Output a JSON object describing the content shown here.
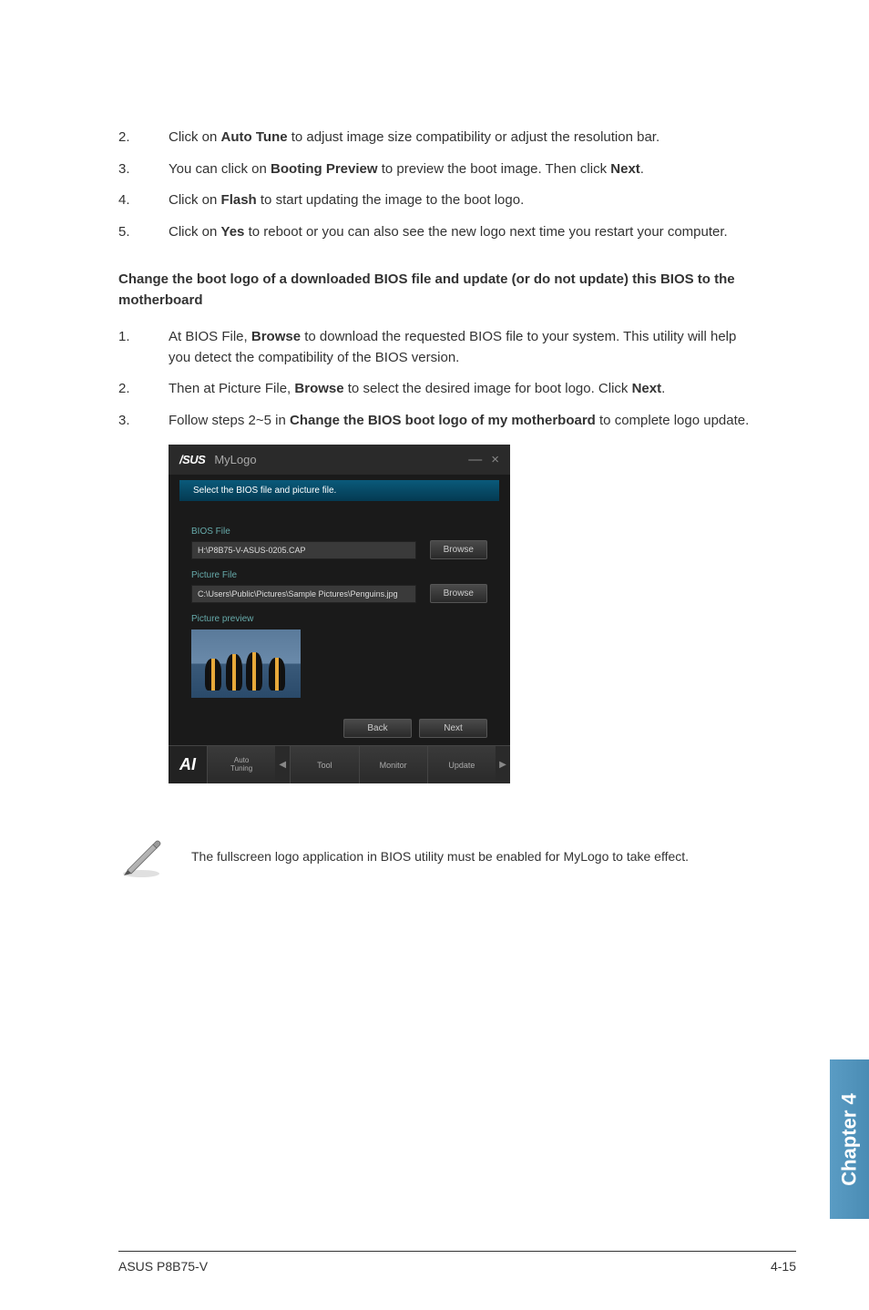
{
  "list1": [
    {
      "num": "2.",
      "parts": [
        "Click on ",
        {
          "b": "Auto Tune"
        },
        " to adjust image size compatibility or adjust the resolution bar."
      ]
    },
    {
      "num": "3.",
      "parts": [
        "You can click on ",
        {
          "b": "Booting Preview"
        },
        " to preview the boot image. Then click ",
        {
          "b": "Next"
        },
        "."
      ]
    },
    {
      "num": "4.",
      "parts": [
        "Click on ",
        {
          "b": "Flash"
        },
        " to start updating the image to the boot logo."
      ]
    },
    {
      "num": "5.",
      "parts": [
        "Click on ",
        {
          "b": "Yes"
        },
        " to reboot or you can also see the new logo next time you restart your computer."
      ]
    }
  ],
  "heading": "Change the boot logo of a downloaded BIOS file and update (or do not update) this BIOS to the motherboard",
  "list2": [
    {
      "num": "1.",
      "parts": [
        "At BIOS File, ",
        {
          "b": "Browse"
        },
        " to download the requested BIOS file to your system. This utility will help you detect the compatibility of the BIOS version."
      ]
    },
    {
      "num": "2.",
      "parts": [
        "Then at Picture File, ",
        {
          "b": "Browse"
        },
        " to select the desired image for boot logo. Click ",
        {
          "b": "Next"
        },
        "."
      ]
    },
    {
      "num": "3.",
      "parts": [
        "Follow steps 2~5 in ",
        {
          "b": "Change the BIOS boot logo of my motherboard"
        },
        " to complete logo update."
      ]
    }
  ],
  "screenshot": {
    "logo": "/SUS",
    "title": "MyLogo",
    "subheader": "Select the BIOS file and picture file.",
    "bios_label": "BIOS File",
    "bios_path": "H:\\P8B75-V-ASUS-0205.CAP",
    "picture_label": "Picture File",
    "picture_path": "C:\\Users\\Public\\Pictures\\Sample Pictures\\Penguins.jpg",
    "browse_label": "Browse",
    "preview_label": "Picture preview",
    "back_label": "Back",
    "next_label": "Next",
    "ai_label": "AI",
    "tabs": {
      "auto_tuning": "Auto\nTuning",
      "tool": "Tool",
      "monitor": "Monitor",
      "update": "Update"
    }
  },
  "note": "The fullscreen logo application in BIOS utility must be enabled for MyLogo to take effect.",
  "side_tab": "Chapter 4",
  "footer_left": "ASUS P8B75-V",
  "footer_right": "4-15"
}
